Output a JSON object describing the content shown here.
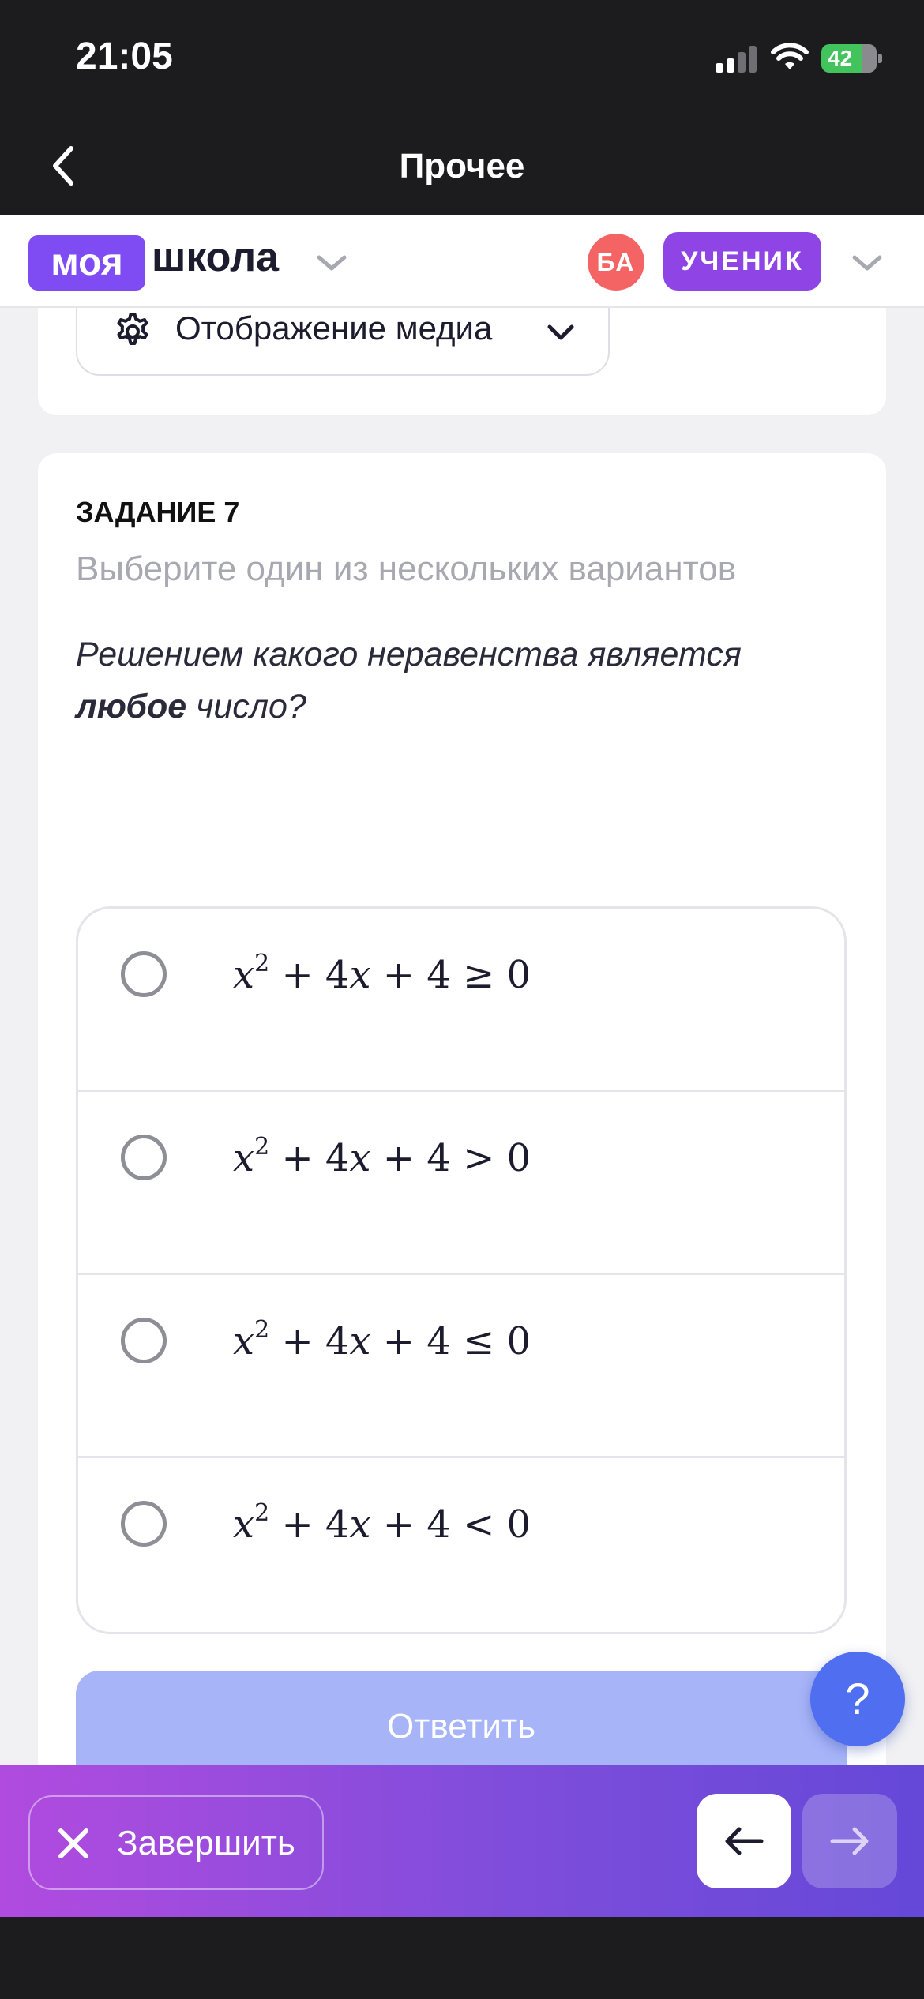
{
  "status_bar": {
    "time": "21:05",
    "battery": "42"
  },
  "nav": {
    "title": "Прочее"
  },
  "header": {
    "logo_badge": "моя",
    "logo_text": "школа",
    "avatar_initials": "БА",
    "role": "УЧЕНИК"
  },
  "media": {
    "label": "Отображение медиа"
  },
  "task": {
    "label": "ЗАДАНИЕ 7",
    "instruction": "Выберите один из нескольких вариантов",
    "question_part1": "Решением какого неравенства является",
    "question_bold": "любое",
    "question_part2": "число?",
    "options": [
      {
        "lhs": "+ 4",
        "mid": "+ 4 ",
        "op": "≥",
        "rhs": "0"
      },
      {
        "lhs": "+ 4",
        "mid": "+ 4 ",
        "op": ">",
        "rhs": "0"
      },
      {
        "lhs": "+ 4",
        "mid": "+ 4 ",
        "op": "≤",
        "rhs": "0"
      },
      {
        "lhs": "+ 4",
        "mid": "+ 4 ",
        "op": "<",
        "rhs": "0"
      }
    ],
    "submit_label": "Ответить"
  },
  "help": {
    "label": "?"
  },
  "bottom_bar": {
    "finish_label": "Завершить"
  }
}
